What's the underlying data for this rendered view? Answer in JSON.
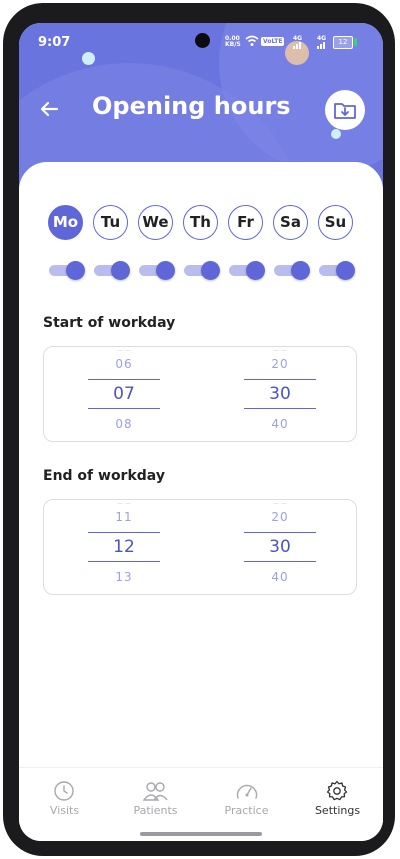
{
  "status_bar": {
    "time": "9:07",
    "net_speed_value": "0.00",
    "net_speed_unit": "KB/S",
    "volte": "VoLTE",
    "network_1": "4G",
    "network_2": "4G",
    "battery": "12"
  },
  "header": {
    "title": "Opening hours",
    "back_icon": "arrow-left-icon",
    "export_icon": "folder-download-icon"
  },
  "days": [
    {
      "label": "Mo",
      "selected": true,
      "enabled": true
    },
    {
      "label": "Tu",
      "selected": false,
      "enabled": true
    },
    {
      "label": "We",
      "selected": false,
      "enabled": true
    },
    {
      "label": "Th",
      "selected": false,
      "enabled": true
    },
    {
      "label": "Fr",
      "selected": false,
      "enabled": true
    },
    {
      "label": "Sa",
      "selected": false,
      "enabled": true
    },
    {
      "label": "Su",
      "selected": false,
      "enabled": true
    }
  ],
  "start": {
    "label": "Start of workday",
    "hours": {
      "prev": "06",
      "current": "07",
      "next": "08"
    },
    "minutes": {
      "prev": "20",
      "current": "30",
      "next": "40"
    }
  },
  "end": {
    "label": "End of workday",
    "hours": {
      "prev": "11",
      "current": "12",
      "next": "13"
    },
    "minutes": {
      "prev": "20",
      "current": "30",
      "next": "40"
    }
  },
  "nav": [
    {
      "label": "Visits",
      "icon": "clock-icon",
      "active": false
    },
    {
      "label": "Patients",
      "icon": "people-icon",
      "active": false
    },
    {
      "label": "Practice",
      "icon": "gauge-icon",
      "active": false
    },
    {
      "label": "Settings",
      "icon": "gear-icon",
      "active": true
    }
  ],
  "colors": {
    "accent": "#5f67d8",
    "header_bg": "#6a74de",
    "toggle_track": "#b9bdee"
  }
}
